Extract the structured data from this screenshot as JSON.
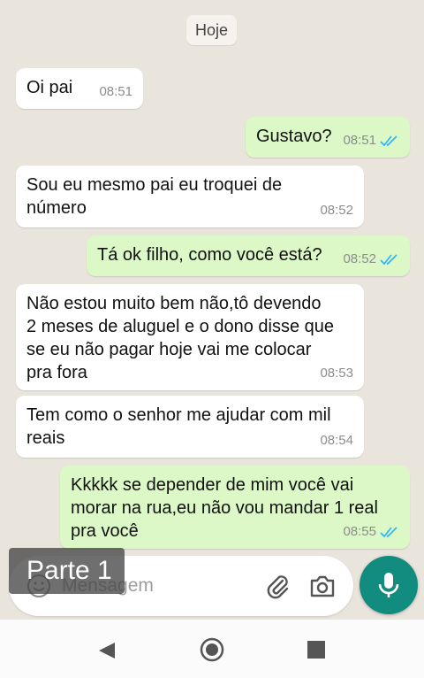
{
  "date_chip": "Hoje",
  "messages": [
    {
      "direction": "in",
      "text": "Oi pai",
      "time": "08:51"
    },
    {
      "direction": "out",
      "text": "Gustavo?",
      "time": "08:51"
    },
    {
      "direction": "in",
      "text": "Sou eu mesmo pai eu troquei de\nnúmero",
      "time": "08:52"
    },
    {
      "direction": "out",
      "text": "Tá ok filho, como você está?",
      "time": "08:52"
    },
    {
      "direction": "in",
      "text": "Não estou muito bem não,tô devendo\n2 meses de aluguel e o dono disse que\nse eu não pagar hoje vai me colocar\npra fora",
      "time": "08:53"
    },
    {
      "direction": "in",
      "text": "Tem como o senhor me ajudar com mil\nreais",
      "time": "08:54"
    },
    {
      "direction": "out",
      "text": "Kkkkk se depender de mim você vai\nmorar na rua,eu não vou mandar 1 real\npra você",
      "time": "08:55"
    }
  ],
  "composer": {
    "placeholder": "Mensagem"
  },
  "overlay": {
    "label": "Parte 1"
  },
  "colors": {
    "outgoing": "#dcf8c6",
    "incoming": "#ffffff",
    "accent": "#128c7e",
    "read_ticks": "#34b7f1"
  },
  "icons": {
    "emoji": "emoji-icon",
    "attach": "paperclip-icon",
    "camera": "camera-icon",
    "mic": "microphone-icon",
    "nav_back": "back-triangle-icon",
    "nav_home": "home-circle-icon",
    "nav_recent": "recent-square-icon"
  }
}
